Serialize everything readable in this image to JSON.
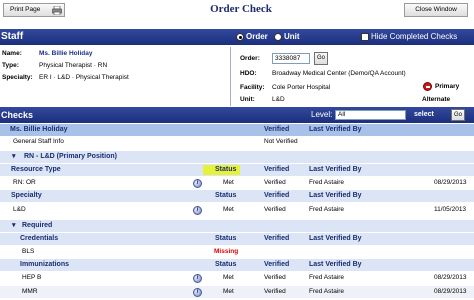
{
  "header": {
    "print_label": "Print Page",
    "title": "Order Check",
    "close_label": "Close Window"
  },
  "staff_bar": {
    "title": "Staff",
    "radio_order": "Order",
    "radio_unit": "Unit",
    "hide_completed": "Hide Completed Checks"
  },
  "staff": {
    "name_label": "Name:",
    "name": "Ms. Billie Holiday",
    "type_label": "Type:",
    "type": "Physical Therapist · RN",
    "specialty_label": "Specialty:",
    "specialty": "ER I · L&D · Physical Therapist"
  },
  "order": {
    "order_label": "Order:",
    "order_value": "3338087",
    "go": "Go",
    "hdo_label": "HDO:",
    "hdo": "Broadway Medical Center (Demo/QA Account)",
    "facility_label": "Facility:",
    "facility": "Cole Porter Hospital",
    "unit_label": "Unit:",
    "unit": "L&D",
    "primary": "Primary",
    "alternate": "Alternate"
  },
  "checks_bar": {
    "title": "Checks",
    "level_label": "Level:",
    "level_value": "All",
    "select_label": "select",
    "go": "Go"
  },
  "columns": {
    "status": "Status",
    "verified": "Verified",
    "last_verified_by": "Last Verified By"
  },
  "rows": {
    "person": "Ms. Billie Holiday",
    "general": {
      "name": "General Staff Info",
      "verified": "Not Verified"
    },
    "position": "RN - L&D (Primary Position)",
    "resource_type": "Resource Type",
    "rn_or": {
      "name": "RN: OR",
      "status": "Met",
      "verified": "Verified",
      "by": "Fred Astaire",
      "date": "08/29/2013"
    },
    "specialty": "Specialty",
    "ld": {
      "name": "L&D",
      "status": "Met",
      "verified": "Verified",
      "by": "Fred Astaire",
      "date": "11/05/2013"
    },
    "required": "Required",
    "credentials": "Credentials",
    "bls": {
      "name": "BLS",
      "status": "Missing"
    },
    "immunizations": "Immunizations",
    "hepb": {
      "name": "HEP B",
      "status": "Met",
      "verified": "Verified",
      "by": "Fred Astaire",
      "date": "08/29/2013"
    },
    "mmr": {
      "name": "MMR",
      "status": "Met",
      "verified": "Verified",
      "by": "Fred Astaire",
      "date": "08/29/2013"
    }
  },
  "colors": {
    "bar_blue": "#24388a",
    "highlight": "#e6f23a",
    "missing": "#e00000"
  }
}
